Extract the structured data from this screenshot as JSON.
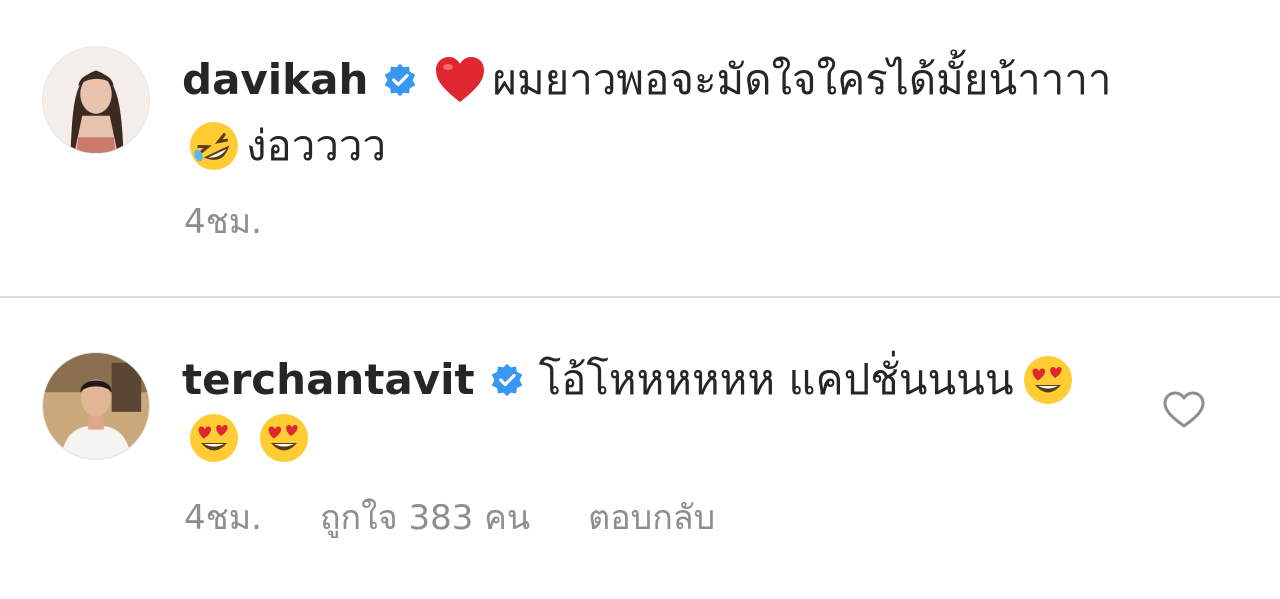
{
  "comments": [
    {
      "username": "davikah",
      "line1_text": "ผมยาวพอจะมัดใจใครได้มั้ยน้าาาา",
      "line2_text": "ง่อวววว",
      "time": "4ชม.",
      "line1_emoji": "red-heart-emoji",
      "line2_emoji": "rofl-emoji"
    },
    {
      "username": "terchantavit",
      "line1_text": "โอ้โหหหหหห แคปชั่นนนน",
      "time": "4ชม.",
      "likes": "ถูกใจ 383 คน",
      "reply": "ตอบกลับ",
      "line1_emoji": "heart-eyes-emoji",
      "line2_emoji": "heart-eyes-emoji"
    }
  ],
  "colors": {
    "verified_blue": "#3897f0",
    "meta_gray": "#8e8e8e",
    "text": "#262626",
    "divider": "#dbdbdb"
  }
}
